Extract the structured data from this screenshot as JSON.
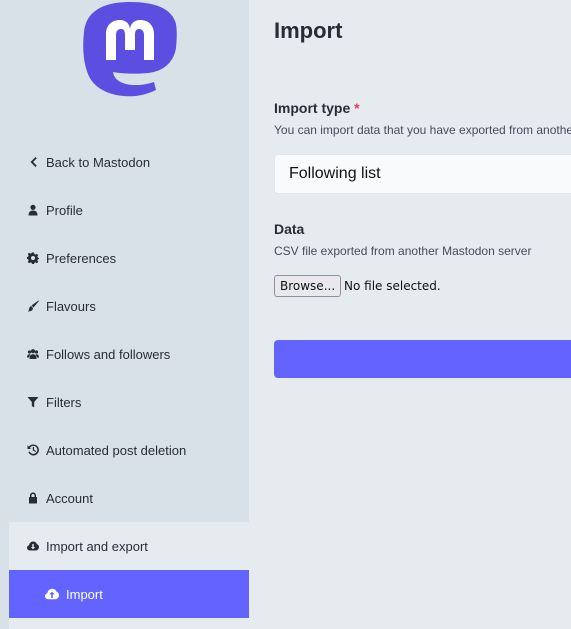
{
  "colors": {
    "accent": "#6364ff",
    "sidebar_bg": "#d9e1e8",
    "main_bg": "#e6ebf0",
    "required": "#df405a"
  },
  "sidebar": {
    "logo": "mastodon-logo",
    "items": [
      {
        "label": "Back to Mastodon",
        "icon": "chevron-left-icon"
      },
      {
        "label": "Profile",
        "icon": "user-icon"
      },
      {
        "label": "Preferences",
        "icon": "gear-icon"
      },
      {
        "label": "Flavours",
        "icon": "paint-brush-icon"
      },
      {
        "label": "Follows and followers",
        "icon": "users-icon"
      },
      {
        "label": "Filters",
        "icon": "filter-icon"
      },
      {
        "label": "Automated post deletion",
        "icon": "history-icon"
      },
      {
        "label": "Account",
        "icon": "lock-icon"
      },
      {
        "label": "Import and export",
        "icon": "cloud-download-icon"
      }
    ],
    "sub_items": [
      {
        "label": "Import",
        "icon": "cloud-upload-icon",
        "active": true
      }
    ]
  },
  "main": {
    "title": "Import",
    "import_type": {
      "label": "Import type",
      "required_mark": "*",
      "hint": "You can import data that you have exported from another server",
      "selected": "Following list"
    },
    "data": {
      "label": "Data",
      "hint": "CSV file exported from another Mastodon server",
      "browse_label": "Browse...",
      "file_status": "No file selected."
    }
  }
}
